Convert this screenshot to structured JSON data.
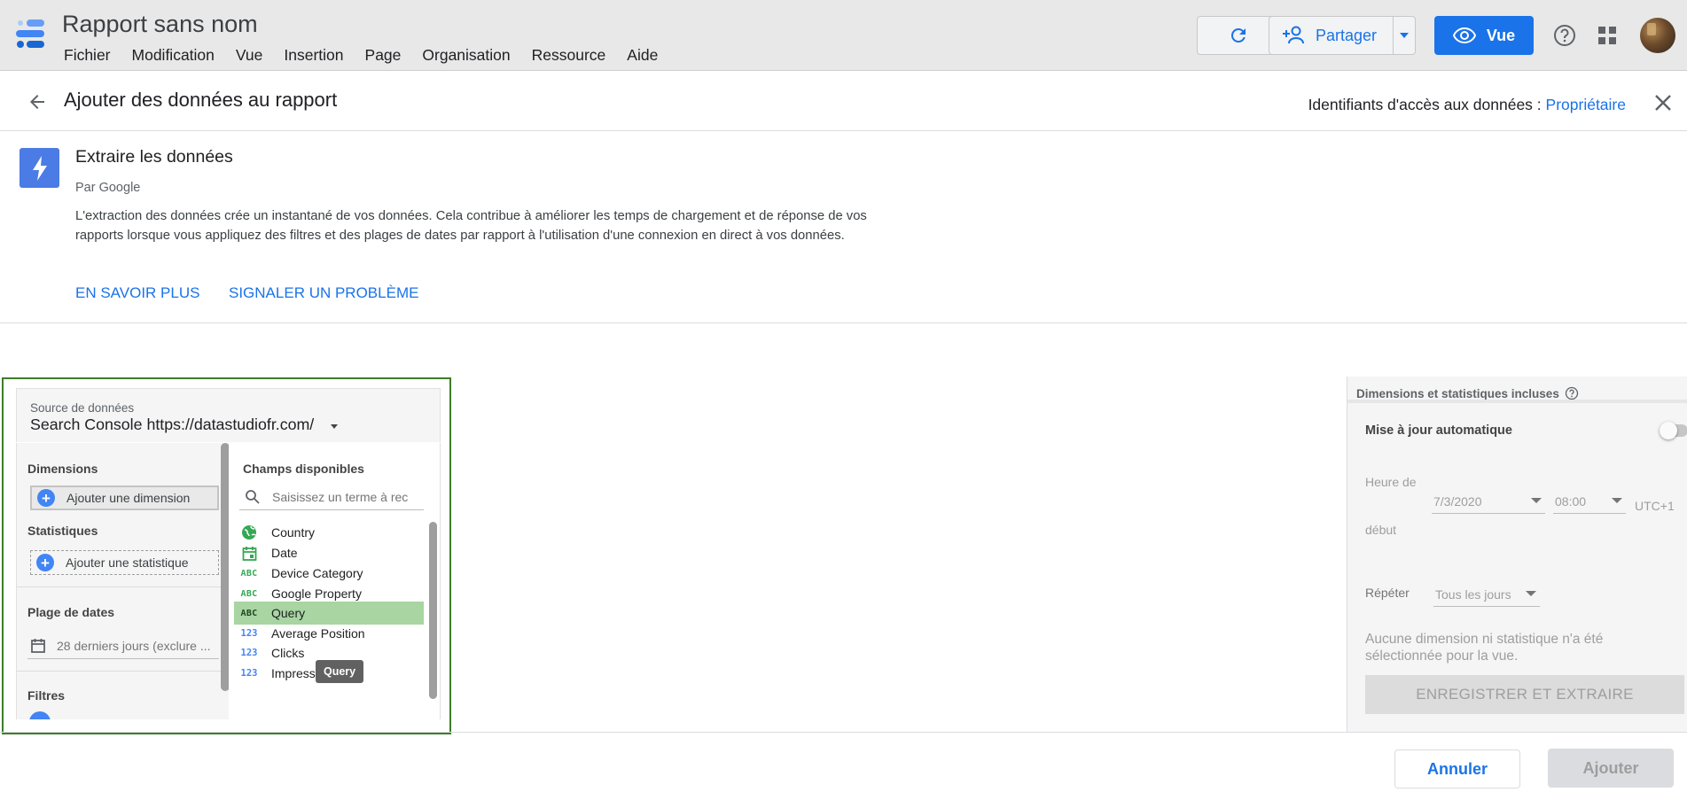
{
  "app": {
    "title": "Rapport sans nom",
    "menu": [
      "Fichier",
      "Modification",
      "Vue",
      "Insertion",
      "Page",
      "Organisation",
      "Ressource",
      "Aide"
    ],
    "share_label": "Partager",
    "view_label": "Vue",
    "accent": "#1a73e8"
  },
  "panel": {
    "title": "Ajouter des données au rapport",
    "access_label": "Identifiants d'accès aux données : ",
    "access_value": "Propriétaire"
  },
  "connector": {
    "name": "Extraire les données",
    "by": "Par Google",
    "description": "L'extraction des données crée un instantané de vos données. Cela contribue à améliorer les temps de chargement et de réponse de vos rapports lorsque vous appliquez des filtres et des plages de dates par rapport à l'utilisation d'une connexion en direct à vos données.",
    "learn_more": "EN SAVOIR PLUS",
    "report_problem": "SIGNALER UN PROBLÈME"
  },
  "config": {
    "source_label": "Source de données",
    "source_value": "Search Console https://datastudiofr.com/",
    "dimensions_label": "Dimensions",
    "add_dimension": "Ajouter une dimension",
    "metrics_label": "Statistiques",
    "add_metric": "Ajouter une statistique",
    "date_range_label": "Plage de dates",
    "date_range_value": "28 derniers jours (exclure ...",
    "filters_label": "Filtres",
    "fields_title": "Champs disponibles",
    "search_placeholder": "Saisissez un terme à rec",
    "fields": [
      {
        "name": "Country",
        "icon": "globe-icon"
      },
      {
        "name": "Date",
        "icon": "calendar-icon"
      },
      {
        "name": "Device Category",
        "icon": "abc-icon"
      },
      {
        "name": "Google Property",
        "icon": "abc-icon"
      },
      {
        "name": "Query",
        "icon": "abc-icon",
        "selected": true
      },
      {
        "name": "Average Position",
        "icon": "123-icon"
      },
      {
        "name": "Clicks",
        "icon": "123-icon"
      },
      {
        "name": "Impressions",
        "icon": "123-icon"
      }
    ],
    "abc_glyph": "ABC",
    "num_glyph": "123",
    "tooltip": "Query"
  },
  "settings": {
    "header": "Dimensions et statistiques incluses",
    "auto_update": "Mise à jour automatique",
    "start_time_label_1": "Heure de",
    "start_time_label_2": "début",
    "start_date": "7/3/2020",
    "start_hour": "08:00",
    "timezone": "UTC+1",
    "repeat_label": "Répéter",
    "repeat_value": "Tous les jours",
    "message": "Aucune dimension ni statistique n'a été sélectionnée pour la vue.",
    "save_extract": "ENREGISTRER ET EXTRAIRE"
  },
  "footer": {
    "cancel": "Annuler",
    "add": "Ajouter"
  }
}
